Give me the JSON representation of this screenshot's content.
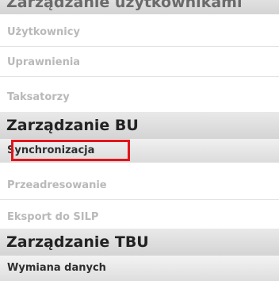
{
  "menu": {
    "top_header": "Zarządzanie użytkownikami",
    "group1": {
      "items": [
        {
          "label": "Użytkownicy"
        },
        {
          "label": "Uprawnienia"
        },
        {
          "label": "Taksatorzy"
        }
      ]
    },
    "group2": {
      "header": "Zarządzanie BU",
      "items": [
        {
          "label": "Synchronizacja"
        },
        {
          "label": "Przeadresowanie"
        },
        {
          "label": "Eksport do SILP"
        }
      ]
    },
    "group3": {
      "header": "Zarządzanie TBU",
      "items": [
        {
          "label": "Wymiana danych"
        }
      ]
    }
  },
  "colors": {
    "highlight_border": "#e3141b",
    "inactive_text": "#b9b9b9",
    "active_text": "#2e2e2e"
  }
}
